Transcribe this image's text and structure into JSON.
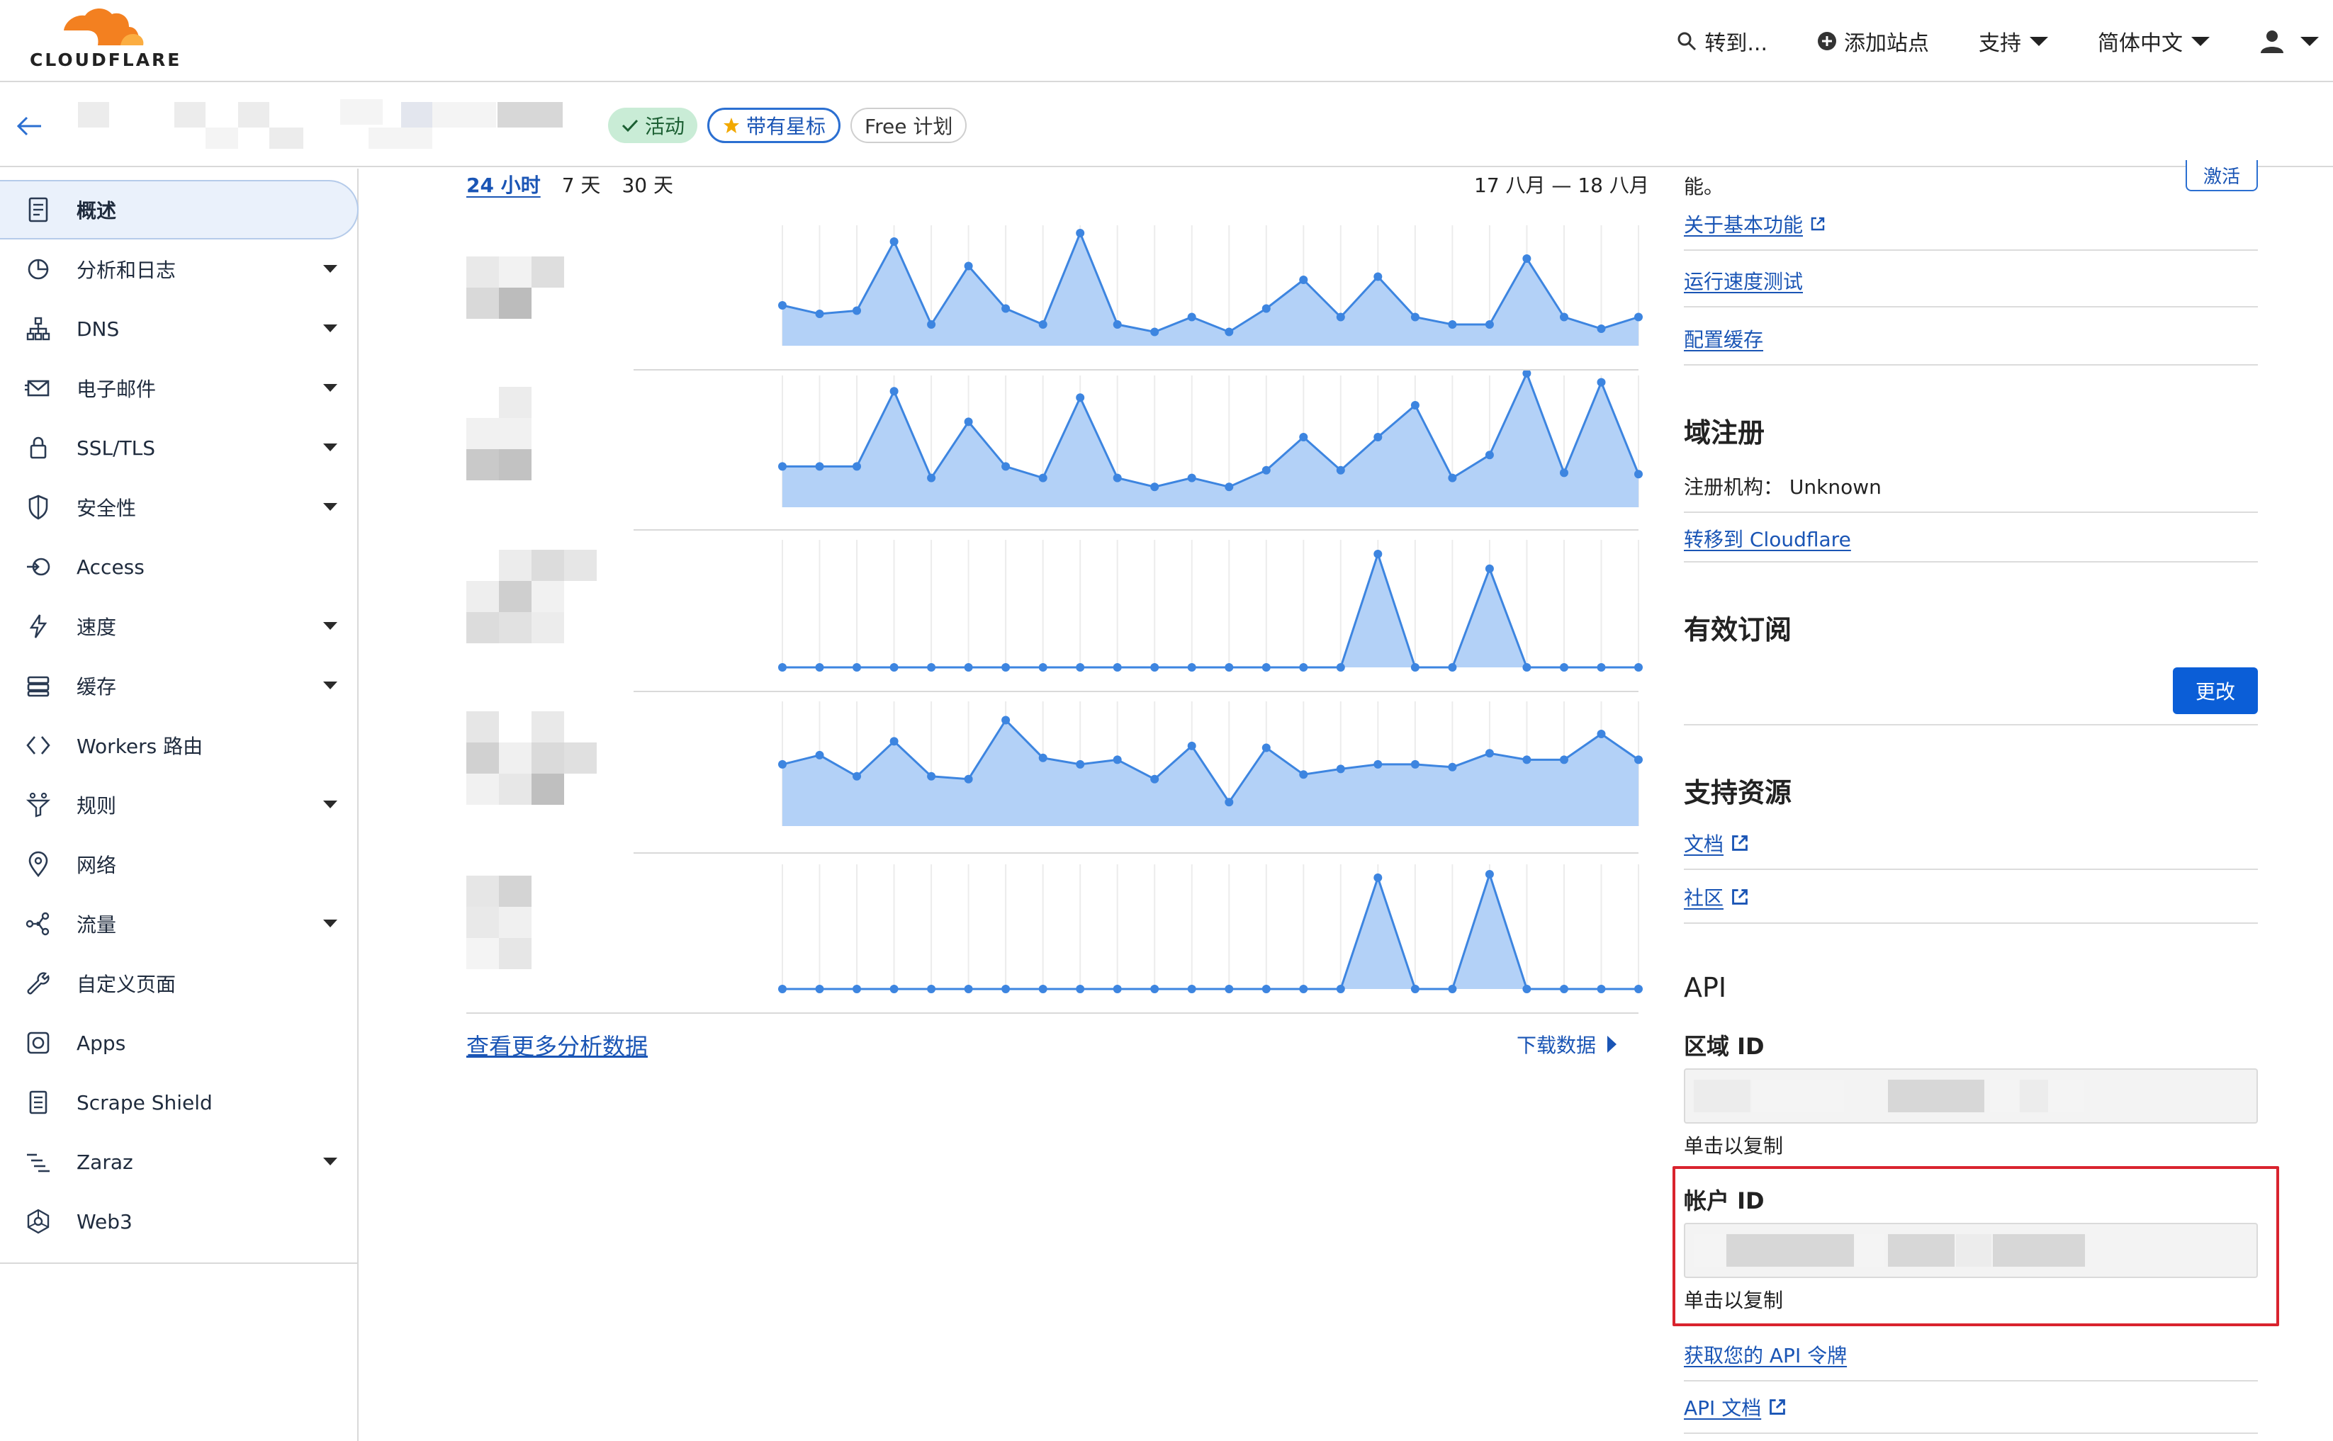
{
  "brand": {
    "logo_text": "CLOUDFLARE",
    "accent": "#f38020",
    "link_color": "#1a55b5"
  },
  "topnav": {
    "search_label": "转到...",
    "add_site_label": "添加站点",
    "support_label": "支持",
    "language_label": "简体中文"
  },
  "zone": {
    "badges": {
      "active": "活动",
      "starred": "带有星标",
      "plan": "Free 计划"
    }
  },
  "sidebar": {
    "items": [
      {
        "label": "概述",
        "icon": "document-icon",
        "has_caret": false,
        "active": true
      },
      {
        "label": "分析和日志",
        "icon": "pie-chart-icon",
        "has_caret": true
      },
      {
        "label": "DNS",
        "icon": "network-tree-icon",
        "has_caret": true
      },
      {
        "label": "电子邮件",
        "icon": "envelope-icon",
        "has_caret": true
      },
      {
        "label": "SSL/TLS",
        "icon": "lock-icon",
        "has_caret": true
      },
      {
        "label": "安全性",
        "icon": "shield-icon",
        "has_caret": true
      },
      {
        "label": "Access",
        "icon": "access-icon",
        "has_caret": false
      },
      {
        "label": "速度",
        "icon": "lightning-icon",
        "has_caret": true
      },
      {
        "label": "缓存",
        "icon": "storage-icon",
        "has_caret": true
      },
      {
        "label": "Workers 路由",
        "icon": "code-brackets-icon",
        "has_caret": false
      },
      {
        "label": "规则",
        "icon": "funnel-icon",
        "has_caret": true
      },
      {
        "label": "网络",
        "icon": "location-pin-icon",
        "has_caret": false
      },
      {
        "label": "流量",
        "icon": "traffic-icon",
        "has_caret": true
      },
      {
        "label": "自定义页面",
        "icon": "wrench-icon",
        "has_caret": false
      },
      {
        "label": "Apps",
        "icon": "apps-icon",
        "has_caret": false
      },
      {
        "label": "Scrape Shield",
        "icon": "page-icon",
        "has_caret": false
      },
      {
        "label": "Zaraz",
        "icon": "zaraz-icon",
        "has_caret": true
      },
      {
        "label": "Web3",
        "icon": "web3-icon",
        "has_caret": false
      }
    ]
  },
  "analytics": {
    "range_tabs": [
      "24 小时",
      "7 天",
      "30 天"
    ],
    "selected_tab": 0,
    "date_range": "17 八月 — 18 八月",
    "more_link": "查看更多分析数据",
    "download_link": "下载数据",
    "series_color": "#3d85e0",
    "fill_color": "#b3d1f7"
  },
  "chart_data": [
    {
      "type": "area",
      "values": [
        0.38,
        0.3,
        0.33,
        0.98,
        0.2,
        0.75,
        0.35,
        0.2,
        1.06,
        0.2,
        0.13,
        0.27,
        0.13,
        0.35,
        0.62,
        0.27,
        0.65,
        0.27,
        0.2,
        0.2,
        0.82,
        0.27,
        0.16,
        0.27
      ]
    },
    {
      "type": "area",
      "values": [
        0.32,
        0.32,
        0.32,
        0.91,
        0.23,
        0.67,
        0.32,
        0.23,
        0.86,
        0.23,
        0.16,
        0.23,
        0.16,
        0.29,
        0.55,
        0.29,
        0.55,
        0.8,
        0.23,
        0.41,
        1.05,
        0.27,
        0.98,
        0.26
      ]
    },
    {
      "type": "area",
      "values": [
        0,
        0,
        0,
        0,
        0,
        0,
        0,
        0,
        0,
        0,
        0,
        0,
        0,
        0,
        0,
        0,
        1,
        0,
        0,
        0.87,
        0,
        0,
        0,
        0
      ]
    },
    {
      "type": "area",
      "values": [
        0.67,
        0.77,
        0.54,
        0.92,
        0.54,
        0.51,
        1.15,
        0.74,
        0.67,
        0.72,
        0.51,
        0.87,
        0.26,
        0.85,
        0.56,
        0.62,
        0.67,
        0.67,
        0.64,
        0.79,
        0.72,
        0.72,
        1.0,
        0.72
      ]
    },
    {
      "type": "area",
      "values": [
        0,
        0,
        0,
        0,
        0,
        0,
        0,
        0,
        0,
        0,
        0,
        0,
        0,
        0,
        0,
        0,
        0.97,
        0,
        0,
        1.0,
        0,
        0,
        0,
        0
      ]
    }
  ],
  "right_panel": {
    "truncated_text": "能。",
    "activate_label": "激活",
    "links_top": [
      "关于基本功能",
      "运行速度测试",
      "配置缓存"
    ],
    "domain_registration": {
      "heading": "域注册",
      "registrar_label": "注册机构：",
      "registrar_value": "Unknown",
      "transfer_link": "转移到 Cloudflare"
    },
    "subscription": {
      "heading": "有效订阅",
      "change_button": "更改"
    },
    "support": {
      "heading": "支持资源",
      "docs_link": "文档",
      "community_link": "社区"
    },
    "api": {
      "heading": "API",
      "zone_id_label": "区域 ID",
      "account_id_label": "帐户 ID",
      "copy_hint": "单击以复制",
      "get_token_link": "获取您的 API 令牌",
      "api_docs_link": "API 文档"
    }
  }
}
